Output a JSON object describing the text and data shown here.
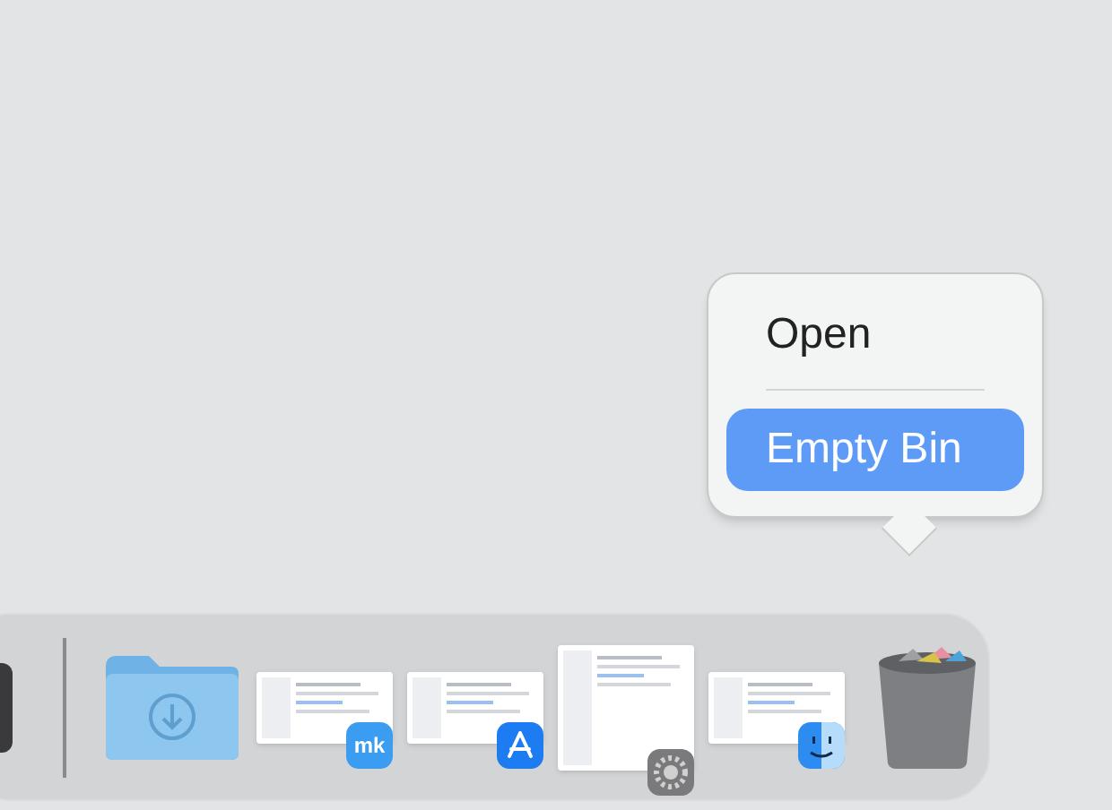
{
  "context_menu": {
    "items": [
      {
        "label": "Open",
        "selected": false
      },
      {
        "label": "Empty Bin",
        "selected": true
      }
    ]
  },
  "dock": {
    "items": [
      {
        "kind": "partial_app"
      },
      {
        "kind": "separator"
      },
      {
        "kind": "folder"
      },
      {
        "kind": "window",
        "badge": {
          "kind": "text",
          "text": "mk"
        },
        "tall": false
      },
      {
        "kind": "window",
        "badge": {
          "kind": "appstore"
        },
        "tall": false
      },
      {
        "kind": "window",
        "badge": {
          "kind": "settings"
        },
        "tall": true
      },
      {
        "kind": "window",
        "badge": {
          "kind": "finder"
        },
        "tall": false
      },
      {
        "kind": "trash"
      }
    ]
  }
}
